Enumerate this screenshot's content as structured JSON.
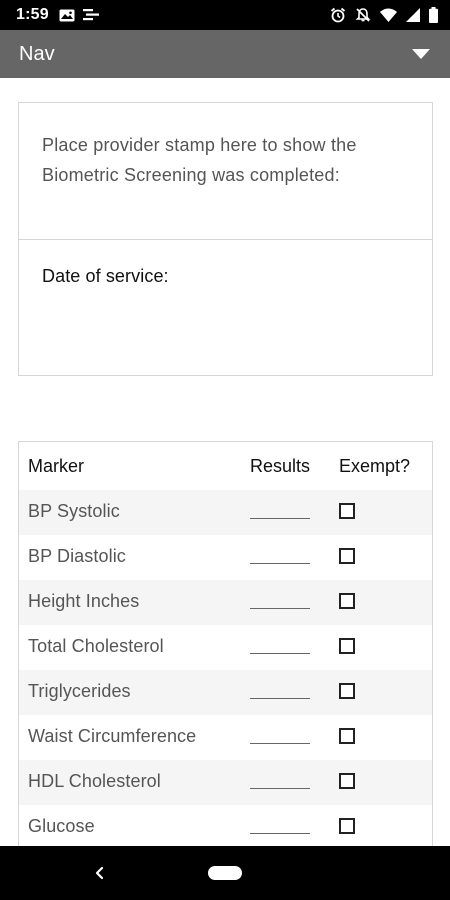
{
  "status_bar": {
    "time": "1:59",
    "left_icons": [
      "photo-icon",
      "notification-icon"
    ],
    "right_icons": [
      "alarm-icon",
      "do-not-disturb-icon",
      "wifi-icon",
      "signal-icon",
      "battery-icon"
    ]
  },
  "nav": {
    "title": "Nav",
    "menu_icon": "caret-down-icon"
  },
  "stamp_section": {
    "instructions": "Place provider stamp here to show the Biometric Screening was completed:",
    "date_label": "Date of service:"
  },
  "table": {
    "headers": {
      "marker": "Marker",
      "results": "Results",
      "exempt": "Exempt?"
    },
    "rows": [
      {
        "marker": "BP Systolic",
        "result": "",
        "exempt": false
      },
      {
        "marker": "BP Diastolic",
        "result": "",
        "exempt": false
      },
      {
        "marker": "Height Inches",
        "result": "",
        "exempt": false
      },
      {
        "marker": "Total Cholesterol",
        "result": "",
        "exempt": false
      },
      {
        "marker": "Triglycerides",
        "result": "",
        "exempt": false
      },
      {
        "marker": "Waist Circumference",
        "result": "",
        "exempt": false
      },
      {
        "marker": "HDL Cholesterol",
        "result": "",
        "exempt": false
      },
      {
        "marker": "Glucose",
        "result": "",
        "exempt": false
      }
    ]
  },
  "system_nav": {
    "back_icon": "back-chevron-icon",
    "home_icon": "home-pill-icon"
  },
  "colors": {
    "nav_background": "#666666",
    "status_bar": "#000000",
    "border": "#d6d6d6",
    "row_shade": "#f5f5f5"
  }
}
